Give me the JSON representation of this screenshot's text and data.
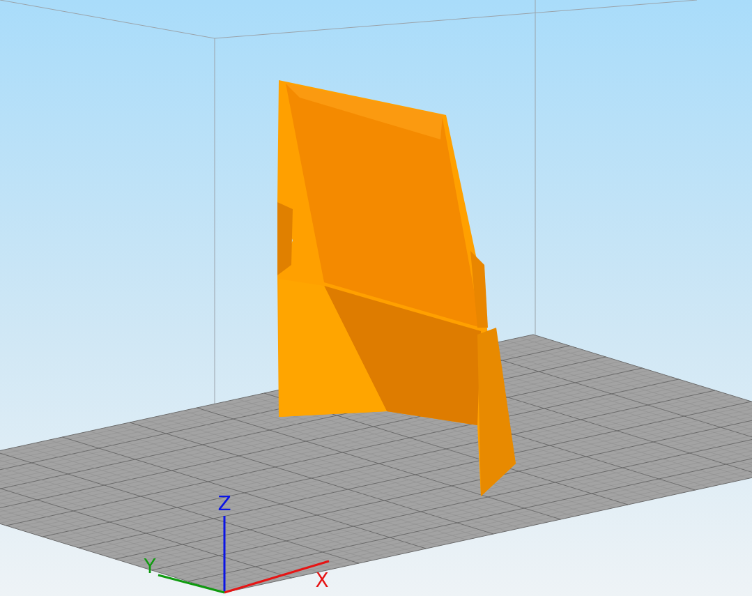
{
  "viewport": {
    "axes": [
      {
        "label": "Z",
        "color": "#0a14e6"
      },
      {
        "label": "X",
        "color": "#e61414"
      },
      {
        "label": "Y",
        "color": "#0f9a0f"
      }
    ]
  }
}
